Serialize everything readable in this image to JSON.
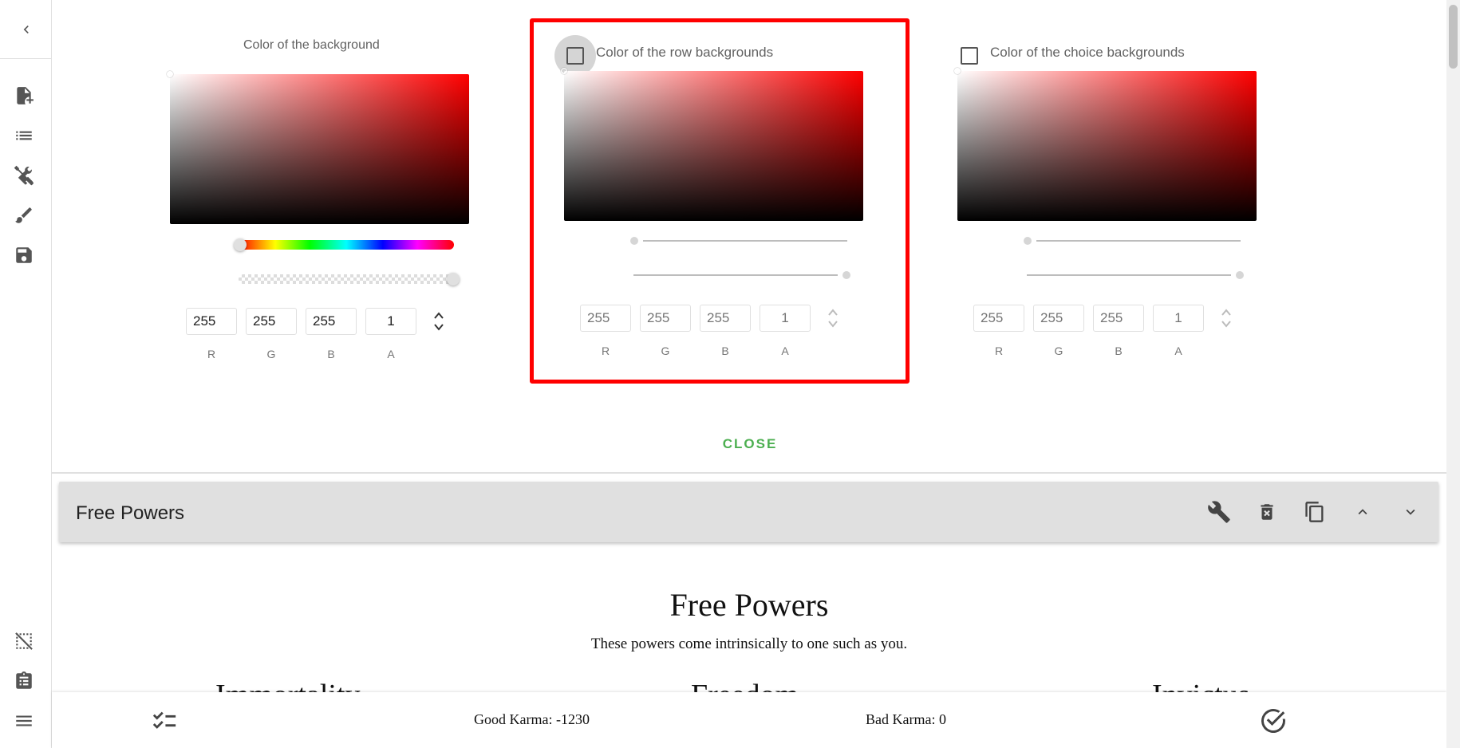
{
  "pickers": [
    {
      "title": "Color of the background",
      "has_checkbox": false,
      "fields": [
        "255",
        "255",
        "255",
        "1"
      ],
      "labels": [
        "R",
        "G",
        "B",
        "A"
      ],
      "hue_fraction": 0.0,
      "alpha_fraction": 1.0
    },
    {
      "title": "Color of the row backgrounds",
      "has_checkbox": true,
      "checked": false,
      "fields": [
        "255",
        "255",
        "255",
        "1"
      ],
      "labels": [
        "R",
        "G",
        "B",
        "A"
      ]
    },
    {
      "title": "Color of the choice backgrounds",
      "has_checkbox": true,
      "checked": false,
      "fields": [
        "255",
        "255",
        "255",
        "1"
      ],
      "labels": [
        "R",
        "G",
        "B",
        "A"
      ]
    }
  ],
  "close_label": "CLOSE",
  "section": {
    "name": "Free Powers"
  },
  "content": {
    "title": "Free Powers",
    "subtitle": "These powers come intrinsically to one such as you.",
    "choices": [
      "Immortality",
      "Freedom",
      "Invictus"
    ]
  },
  "bottom": {
    "good_karma": "Good Karma: -1230",
    "bad_karma": "Bad Karma: 0"
  },
  "colors": {
    "accent_green": "#4caf50",
    "highlight_red": "#ff0000",
    "bar_grey": "#e0e0e0"
  },
  "icons": {
    "rail": [
      "chevron-left-icon",
      "file-add-icon",
      "list-icon",
      "tools-icon",
      "brush-icon",
      "save-icon",
      "grid-off-icon",
      "clipboard-icon",
      "menu-icon"
    ],
    "bar": [
      "wrench-icon",
      "delete-icon",
      "copy-icon",
      "chevron-up-icon",
      "chevron-down-icon"
    ],
    "bottom": [
      "checklist-icon",
      "check-circle-icon"
    ]
  }
}
